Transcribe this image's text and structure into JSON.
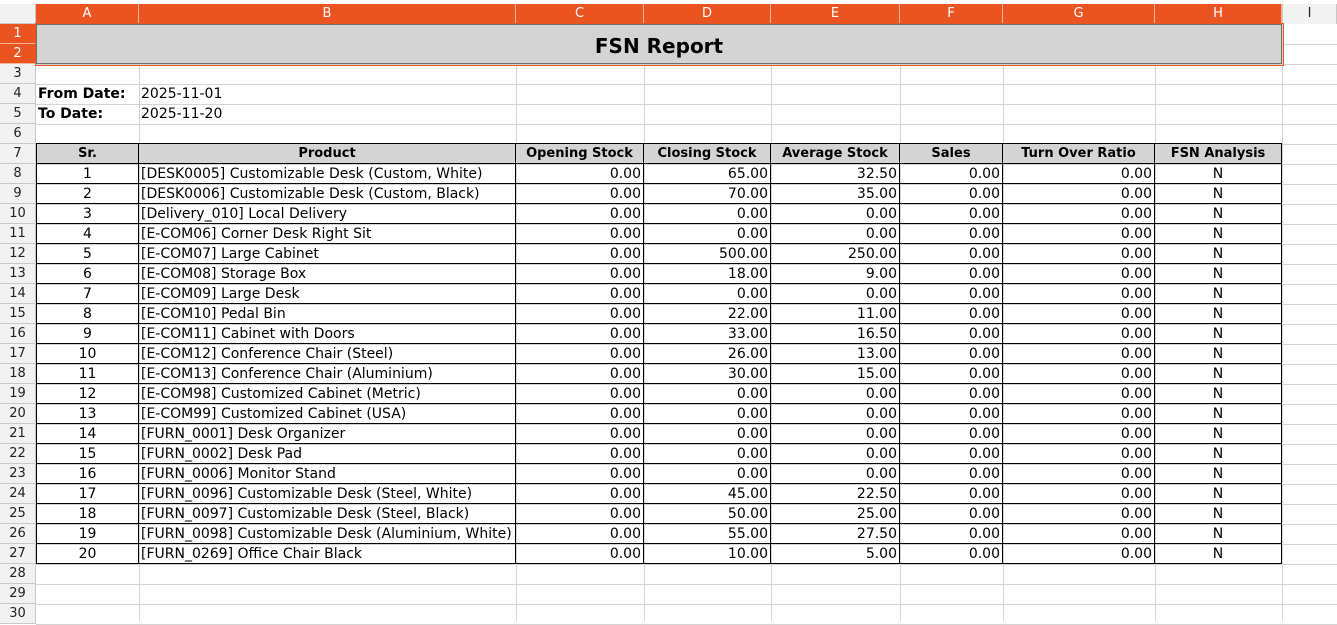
{
  "columns": [
    "A",
    "B",
    "C",
    "D",
    "E",
    "F",
    "G",
    "H",
    "I"
  ],
  "rows": [
    "1",
    "2",
    "3",
    "4",
    "5",
    "6",
    "7",
    "8",
    "9",
    "10",
    "11",
    "12",
    "13",
    "14",
    "15",
    "16",
    "17",
    "18",
    "19",
    "20",
    "21",
    "22",
    "23",
    "24",
    "25",
    "26",
    "27",
    "28",
    "29",
    "30"
  ],
  "title": "FSN Report",
  "from_label": "From Date:",
  "from_value": "2025-11-01",
  "to_label": "To Date:",
  "to_value": "2025-11-20",
  "table": {
    "headers": [
      "Sr.",
      "Product",
      "Opening Stock",
      "Closing Stock",
      "Average Stock",
      "Sales",
      "Turn Over Ratio",
      "FSN Analysis"
    ],
    "rows": [
      [
        "1",
        "[DESK0005] Customizable Desk (Custom, White)",
        "0.00",
        "65.00",
        "32.50",
        "0.00",
        "0.00",
        "N"
      ],
      [
        "2",
        "[DESK0006] Customizable Desk (Custom, Black)",
        "0.00",
        "70.00",
        "35.00",
        "0.00",
        "0.00",
        "N"
      ],
      [
        "3",
        "[Delivery_010] Local Delivery",
        "0.00",
        "0.00",
        "0.00",
        "0.00",
        "0.00",
        "N"
      ],
      [
        "4",
        "[E-COM06] Corner Desk Right Sit",
        "0.00",
        "0.00",
        "0.00",
        "0.00",
        "0.00",
        "N"
      ],
      [
        "5",
        "[E-COM07] Large Cabinet",
        "0.00",
        "500.00",
        "250.00",
        "0.00",
        "0.00",
        "N"
      ],
      [
        "6",
        "[E-COM08] Storage Box",
        "0.00",
        "18.00",
        "9.00",
        "0.00",
        "0.00",
        "N"
      ],
      [
        "7",
        "[E-COM09] Large Desk",
        "0.00",
        "0.00",
        "0.00",
        "0.00",
        "0.00",
        "N"
      ],
      [
        "8",
        "[E-COM10] Pedal Bin",
        "0.00",
        "22.00",
        "11.00",
        "0.00",
        "0.00",
        "N"
      ],
      [
        "9",
        "[E-COM11] Cabinet with Doors",
        "0.00",
        "33.00",
        "16.50",
        "0.00",
        "0.00",
        "N"
      ],
      [
        "10",
        "[E-COM12] Conference Chair (Steel)",
        "0.00",
        "26.00",
        "13.00",
        "0.00",
        "0.00",
        "N"
      ],
      [
        "11",
        "[E-COM13] Conference Chair (Aluminium)",
        "0.00",
        "30.00",
        "15.00",
        "0.00",
        "0.00",
        "N"
      ],
      [
        "12",
        "[E-COM98] Customized Cabinet (Metric)",
        "0.00",
        "0.00",
        "0.00",
        "0.00",
        "0.00",
        "N"
      ],
      [
        "13",
        "[E-COM99] Customized Cabinet (USA)",
        "0.00",
        "0.00",
        "0.00",
        "0.00",
        "0.00",
        "N"
      ],
      [
        "14",
        "[FURN_0001] Desk Organizer",
        "0.00",
        "0.00",
        "0.00",
        "0.00",
        "0.00",
        "N"
      ],
      [
        "15",
        "[FURN_0002] Desk Pad",
        "0.00",
        "0.00",
        "0.00",
        "0.00",
        "0.00",
        "N"
      ],
      [
        "16",
        "[FURN_0006] Monitor Stand",
        "0.00",
        "0.00",
        "0.00",
        "0.00",
        "0.00",
        "N"
      ],
      [
        "17",
        "[FURN_0096] Customizable Desk (Steel, White)",
        "0.00",
        "45.00",
        "22.50",
        "0.00",
        "0.00",
        "N"
      ],
      [
        "18",
        "[FURN_0097] Customizable Desk (Steel, Black)",
        "0.00",
        "50.00",
        "25.00",
        "0.00",
        "0.00",
        "N"
      ],
      [
        "19",
        "[FURN_0098] Customizable Desk (Aluminium, White)",
        "0.00",
        "55.00",
        "27.50",
        "0.00",
        "0.00",
        "N"
      ],
      [
        "20",
        "[FURN_0269] Office Chair Black",
        "0.00",
        "10.00",
        "5.00",
        "0.00",
        "0.00",
        "N"
      ]
    ]
  },
  "colors": {
    "accent": "#e95420",
    "header_fill": "#d4d4d4",
    "grid": "#d4d4d4"
  }
}
